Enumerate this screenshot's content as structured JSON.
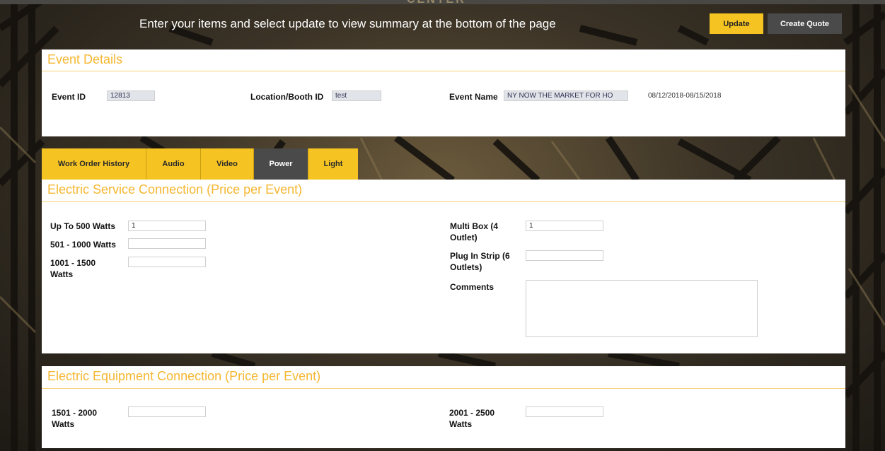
{
  "header": {
    "logo_text": "CENTER",
    "instruction": "Enter your items and select update to view summary at the bottom of the page",
    "update_label": "Update",
    "create_quote_label": "Create Quote"
  },
  "event_details": {
    "title": "Event Details",
    "event_id_label": "Event ID",
    "event_id_value": "12813",
    "location_label": "Location/Booth ID",
    "location_value": "test",
    "event_name_label": "Event Name",
    "event_name_value": "NY NOW THE MARKET FOR HO",
    "date_range": "08/12/2018-08/15/2018"
  },
  "tabs": [
    {
      "label": "Work Order History"
    },
    {
      "label": "Audio"
    },
    {
      "label": "Video"
    },
    {
      "label": "Power",
      "active": true
    },
    {
      "label": "Light"
    }
  ],
  "service": {
    "title": "Electric Service Connection (Price per Event)",
    "up_to_500_label": "Up To 500 Watts",
    "up_to_500_value": "1",
    "w501_1000_label": "501 - 1000 Watts",
    "w501_1000_value": "",
    "w1001_1500_label": "1001 - 1500 Watts",
    "w1001_1500_value": "",
    "multibox_label": "Multi Box (4 Outlet)",
    "multibox_value": "1",
    "plugstrip_label": "Plug In Strip (6 Outlets)",
    "plugstrip_value": "",
    "comments_label": "Comments",
    "comments_value": ""
  },
  "equipment": {
    "title": "Electric Equipment Connection (Price per Event)",
    "w1501_2000_label": "1501 - 2000 Watts",
    "w1501_2000_value": "",
    "w2001_2500_label": "2001 - 2500 Watts",
    "w2001_2500_value": ""
  },
  "colors": {
    "accent": "#f6c422",
    "title": "#f5b731",
    "dark_button": "#4a4a4a"
  }
}
